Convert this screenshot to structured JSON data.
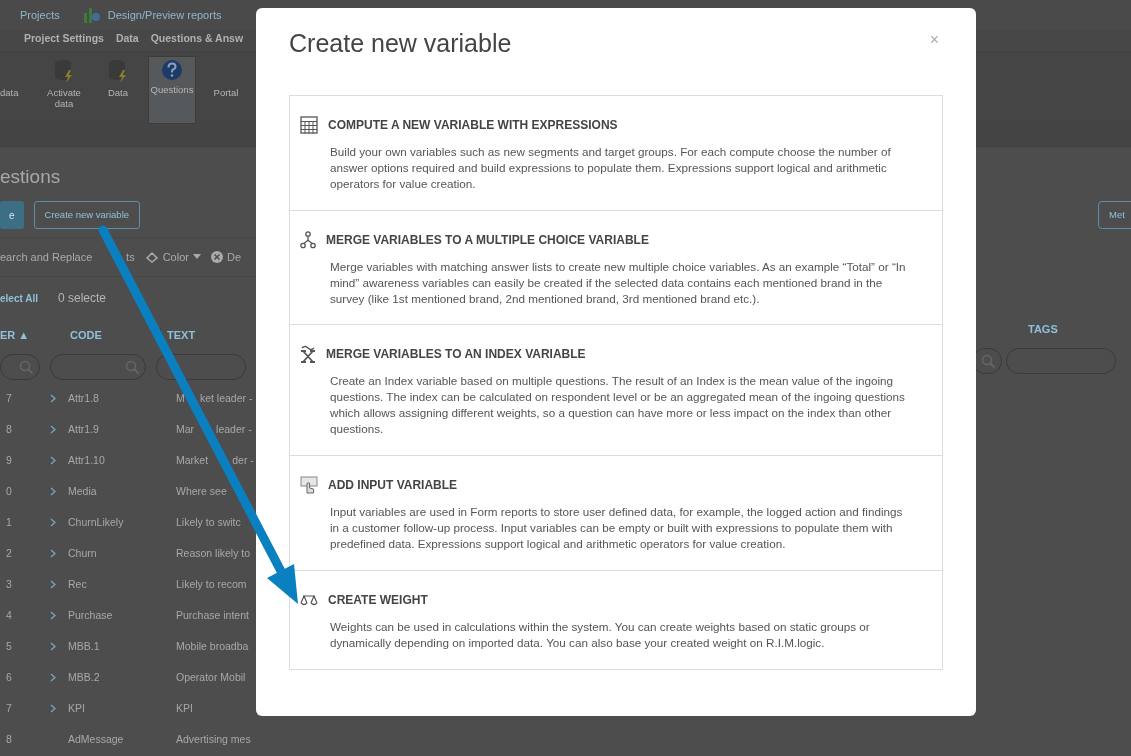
{
  "app": {
    "top_bar": [
      {
        "kind": "projects",
        "label": "Projects"
      },
      {
        "kind": "reports",
        "label": "Design/Preview reports"
      }
    ],
    "tabs": [
      {
        "label": "Project Settings"
      },
      {
        "label": "Data"
      },
      {
        "label": "Questions & Answ"
      }
    ],
    "ribbon": [
      {
        "kind": "plain",
        "label": "data",
        "selected": false
      },
      {
        "kind": "database",
        "label": "Activate data",
        "selected": false
      },
      {
        "kind": "database",
        "label": "Data",
        "selected": false
      },
      {
        "kind": "question",
        "label": "Questions",
        "selected": true
      },
      {
        "kind": "plain",
        "label": "Portal",
        "selected": false
      }
    ],
    "page_title": "estions",
    "buttons": [
      {
        "kind": "primary",
        "label": "e"
      },
      {
        "kind": "outline",
        "label": "Create new variable"
      }
    ],
    "right_button": "Met",
    "toolbar": [
      {
        "kind": "text",
        "parts": [
          "earch and Replace",
          "ts"
        ]
      },
      {
        "kind": "color",
        "label": "Color"
      },
      {
        "kind": "delete",
        "label": "De"
      }
    ],
    "select_all": "elect All",
    "selected_count": "0 selecte",
    "columns": [
      "ER ▲",
      "CODE",
      "TEXT"
    ],
    "right_column": "TAGS",
    "rows": [
      {
        "number": "7",
        "expandable": true,
        "code": "Attr1.8",
        "text_parts": [
          "M",
          "ket leader -"
        ]
      },
      {
        "number": "8",
        "expandable": true,
        "code": "Attr1.9",
        "text_parts": [
          "Mar",
          "leader -"
        ]
      },
      {
        "number": "9",
        "expandable": true,
        "code": "Attr1.10",
        "text_parts": [
          "Market",
          "der -"
        ]
      },
      {
        "number": "0",
        "expandable": true,
        "code": "Media",
        "text_parts": [
          "Where see"
        ]
      },
      {
        "number": "1",
        "expandable": true,
        "code": "ChurnLikely",
        "text_parts": [
          "Likely to switc"
        ]
      },
      {
        "number": "2",
        "expandable": true,
        "code": "Churn",
        "text_parts": [
          "Reason likely to"
        ]
      },
      {
        "number": "3",
        "expandable": true,
        "code": "Rec",
        "text_parts": [
          "Likely to recom"
        ]
      },
      {
        "number": "4",
        "expandable": true,
        "code": "Purchase",
        "text_parts": [
          "Purchase intent"
        ]
      },
      {
        "number": "5",
        "expandable": true,
        "code": "MBB.1",
        "text_parts": [
          "Mobile broadba"
        ]
      },
      {
        "number": "6",
        "expandable": true,
        "code": "MBB.2",
        "text_parts": [
          "Operator Mobil"
        ]
      },
      {
        "number": "7",
        "expandable": true,
        "code": "KPI",
        "text_parts": [
          "KPI"
        ]
      },
      {
        "number": "8",
        "expandable": false,
        "code": "AdMessage",
        "text_parts": [
          "Advertising mes"
        ]
      }
    ]
  },
  "modal": {
    "title": "Create new variable",
    "close": "×",
    "options": [
      {
        "kind": "compute",
        "title": "COMPUTE A NEW VARIABLE WITH EXPRESSIONS",
        "description": "Build your own variables such as new segments and target groups. For each compute choose the number of answer options required and build expressions to populate them. Expressions support logical and arithmetic operators for value creation."
      },
      {
        "kind": "merge",
        "title": "MERGE VARIABLES TO A MULTIPLE CHOICE VARIABLE",
        "description": "Merge variables with matching answer lists to create new multiple choice variables. As an example “Total” or “In mind” awareness variables can easily be created if the selected data contains each mentioned brand in the survey (like 1st mentioned brand, 2nd mentioned brand, 3rd mentioned brand etc.)."
      },
      {
        "kind": "index",
        "title": "MERGE VARIABLES TO AN INDEX VARIABLE",
        "description": "Create an Index variable based on multiple questions. The result of an Index is the mean value of the ingoing questions. The index can be calculated on respondent level or be an aggregated mean of the ingoing questions which allows assigning different weights, so a question can have more or less impact on the index than other questions."
      },
      {
        "kind": "input",
        "title": "ADD INPUT VARIABLE",
        "description": "Input variables are used in Form reports to store user defined data, for example, the logged action and findings in a customer follow-up process. Input variables can be empty or built with expressions to populate them with predefined data. Expressions support logical and arithmetic operators for value creation."
      },
      {
        "kind": "weight",
        "title": "CREATE WEIGHT",
        "description": "Weights can be used in calculations within the system. You can create weights based on static groups or dynamically depending on imported data. You can also base your created weight on R.I.M.logic."
      }
    ]
  }
}
